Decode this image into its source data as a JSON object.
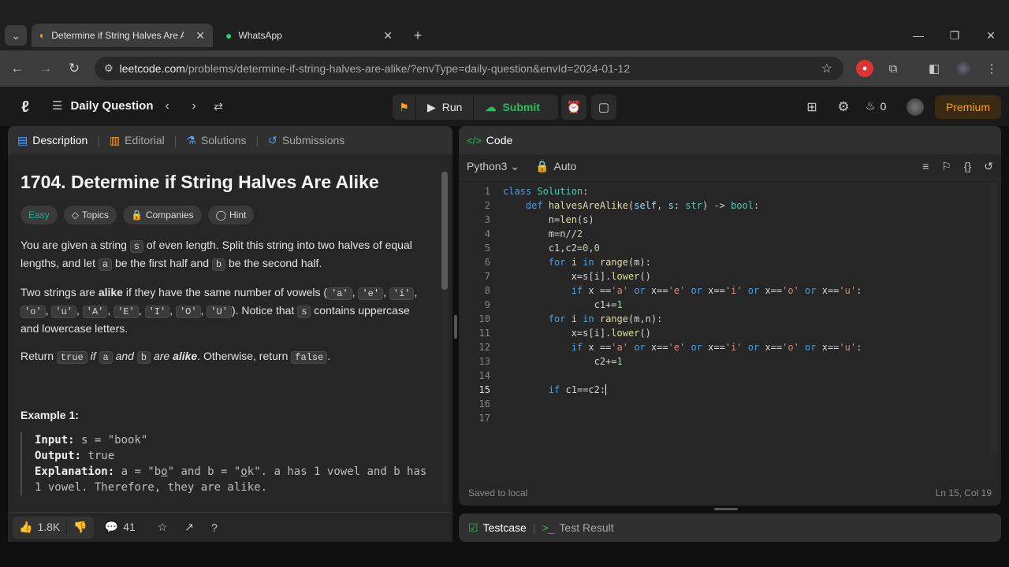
{
  "browser": {
    "tabs": [
      {
        "title": "Determine if String Halves Are Alike",
        "active": true
      },
      {
        "title": "WhatsApp",
        "active": false
      }
    ],
    "url_host": "leetcode.com",
    "url_path": "/problems/determine-if-string-halves-are-alike/?envType=daily-question&envId=2024-01-12"
  },
  "header": {
    "nav_label": "Daily Question",
    "run_label": "Run",
    "submit_label": "Submit",
    "streak_count": "0",
    "premium_label": "Premium"
  },
  "left_tabs": [
    "Description",
    "Editorial",
    "Solutions",
    "Submissions"
  ],
  "problem": {
    "title": "1704. Determine if String Halves Are Alike",
    "difficulty": "Easy",
    "tags": [
      "Topics",
      "Companies",
      "Hint"
    ],
    "p1_a": "You are given a string ",
    "p1_code": "s",
    "p1_b": " of even length. Split this string into two halves of equal lengths, and let ",
    "p1_code2": "a",
    "p1_c": " be the first half and ",
    "p1_code3": "b",
    "p1_d": " be the second half.",
    "p2_a": "Two strings are ",
    "p2_bold": "alike",
    "p2_b": " if they have the same number of vowels (",
    "vowels": [
      "'a'",
      "'e'",
      "'i'",
      "'o'",
      "'u'",
      "'A'",
      "'E'",
      "'I'",
      "'O'",
      "'U'"
    ],
    "p2_c": "). Notice that ",
    "p2_code": "s",
    "p2_d": " contains uppercase and lowercase letters.",
    "p3_a": "Return ",
    "p3_true": "true",
    "p3_b": " if ",
    "p3_a_code": "a",
    "p3_c": " and ",
    "p3_b_code": "b",
    "p3_d": " are ",
    "p3_bold": "alike",
    "p3_e": ". Otherwise, return ",
    "p3_false": "false",
    "p3_f": ".",
    "example_title": "Example 1:",
    "ex_input_label": "Input:",
    "ex_input": " s = \"book\"",
    "ex_output_label": "Output:",
    "ex_output": " true",
    "ex_expl_label": "Explanation:",
    "ex_expl_1": " a = \"b",
    "ex_expl_1u": "o",
    "ex_expl_2": "\" and b = \"",
    "ex_expl_2u": "o",
    "ex_expl_3": "k\". a has 1 vowel and b has 1 vowel. Therefore, they are alike."
  },
  "footer_left": {
    "likes": "1.8K",
    "comments": "41"
  },
  "code_panel": {
    "tab_label": "Code",
    "language": "Python3",
    "mode": "Auto",
    "status": "Saved to local",
    "cursor": "Ln 15, Col 19"
  },
  "bottom_tabs": [
    "Testcase",
    "Test Result"
  ],
  "icons": [
    "leetcode-logo-icon",
    "list-icon",
    "shuffle-icon",
    "play-icon",
    "upload-icon",
    "alarm-icon",
    "note-icon",
    "layout-icon",
    "gear-icon",
    "fire-icon",
    "avatar"
  ],
  "colors": {
    "accent_orange": "#ffa116",
    "submit_green": "#2cbb5d",
    "easy_teal": "#00b8a3",
    "premium": "#ffa116"
  }
}
